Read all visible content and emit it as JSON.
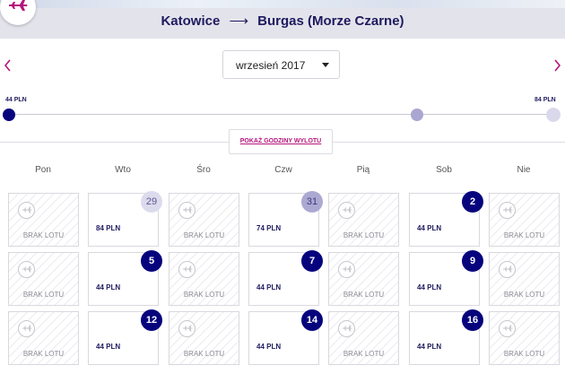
{
  "header": {
    "origin": "Katowice",
    "arrow": "⟶",
    "destination": "Burgas (Morze Czarne)"
  },
  "month_picker": {
    "selected": "wrzesień 2017"
  },
  "price_range": {
    "min_label": "44 PLN",
    "max_label": "84 PLN",
    "min": 44,
    "max": 84
  },
  "show_times_button": "POKAŻ GODZINY WYLOTU",
  "weekdays": [
    "Pon",
    "Wto",
    "Śro",
    "Czw",
    "Pią",
    "Sob",
    "Nie"
  ],
  "no_flight_label": "BRAK LOTU",
  "calendar_rows": [
    [
      {
        "status": "none"
      },
      {
        "status": "flight",
        "day": "29",
        "price": "84 PLN",
        "badge": "prev"
      },
      {
        "status": "none"
      },
      {
        "status": "flight",
        "day": "31",
        "price": "74 PLN",
        "badge": "prev-dark"
      },
      {
        "status": "none"
      },
      {
        "status": "flight",
        "day": "2",
        "price": "44 PLN",
        "badge": "cur"
      },
      {
        "status": "none"
      }
    ],
    [
      {
        "status": "none"
      },
      {
        "status": "flight",
        "day": "5",
        "price": "44 PLN",
        "badge": "cur"
      },
      {
        "status": "none"
      },
      {
        "status": "flight",
        "day": "7",
        "price": "44 PLN",
        "badge": "cur"
      },
      {
        "status": "none"
      },
      {
        "status": "flight",
        "day": "9",
        "price": "44 PLN",
        "badge": "cur"
      },
      {
        "status": "none"
      }
    ],
    [
      {
        "status": "none"
      },
      {
        "status": "flight",
        "day": "12",
        "price": "44 PLN",
        "badge": "cur"
      },
      {
        "status": "none"
      },
      {
        "status": "flight",
        "day": "14",
        "price": "44 PLN",
        "badge": "cur"
      },
      {
        "status": "none"
      },
      {
        "status": "flight",
        "day": "16",
        "price": "44 PLN",
        "badge": "cur"
      },
      {
        "status": "none"
      }
    ]
  ],
  "colors": {
    "brand_navy": "#06037d",
    "accent_magenta": "#b5167c",
    "text_navy": "#1e1a5f"
  }
}
